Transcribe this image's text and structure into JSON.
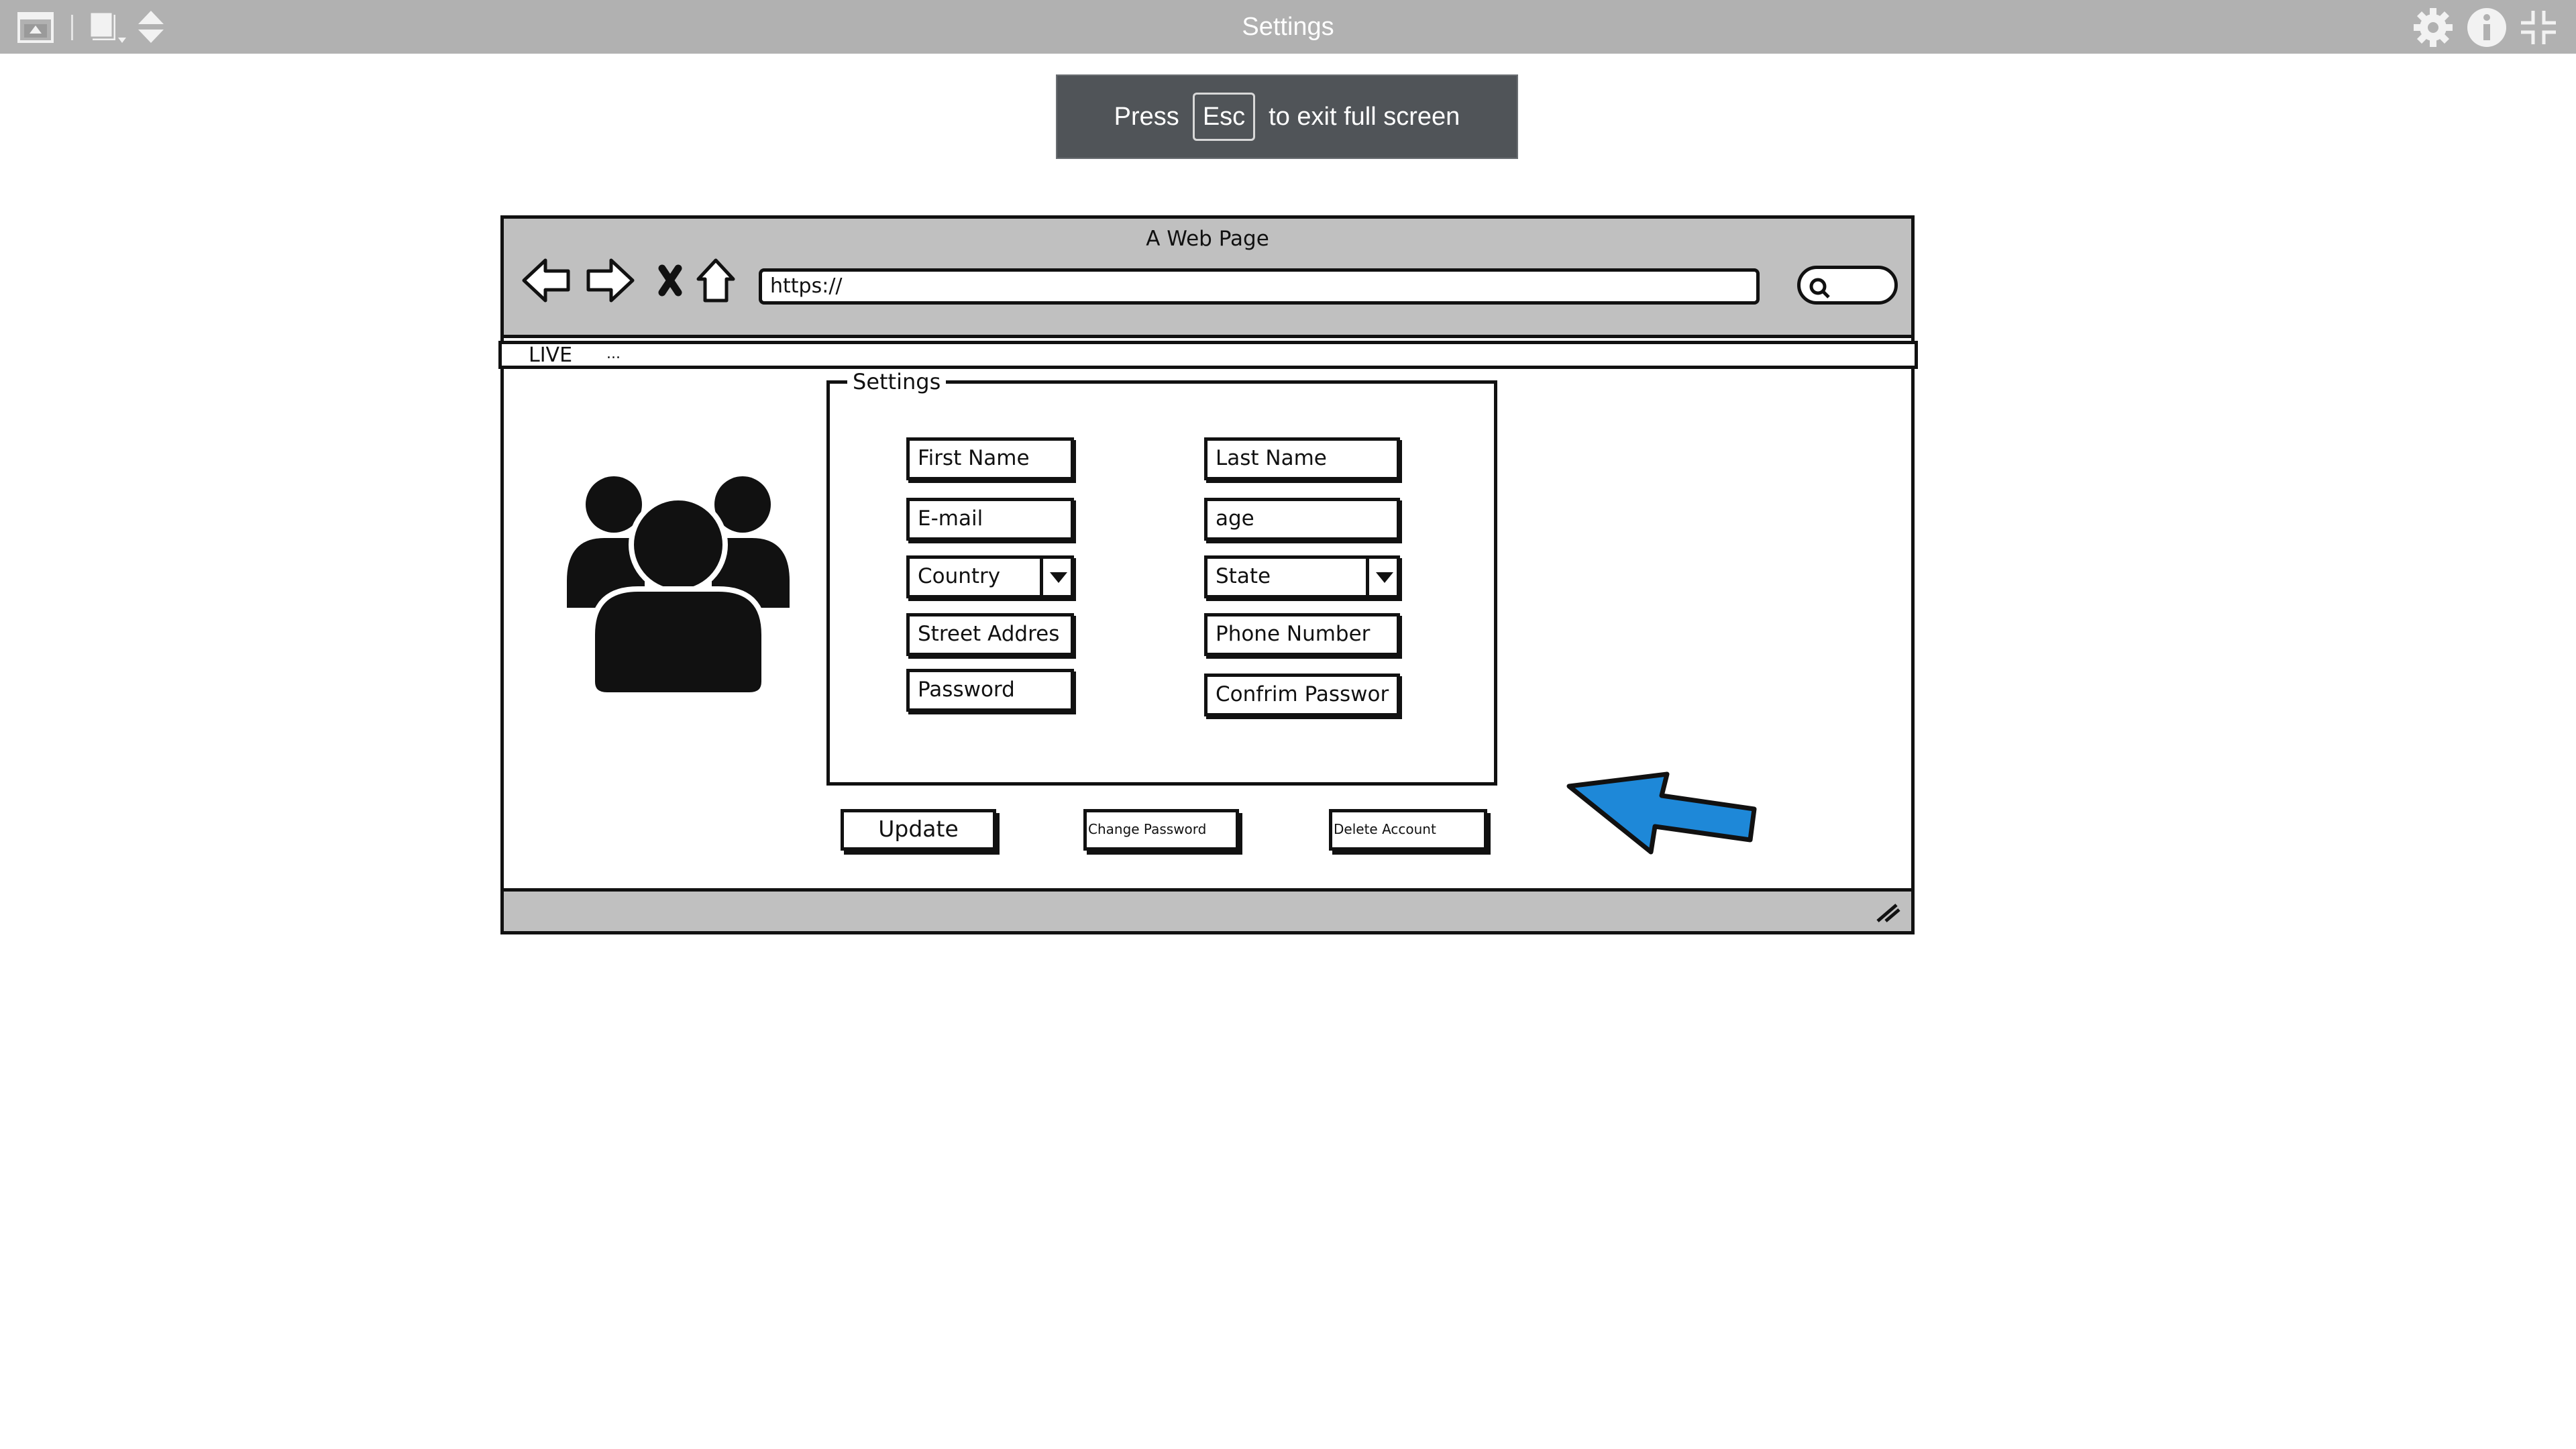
{
  "app": {
    "title": "Settings",
    "icons": [
      "window-icon",
      "pages-icon",
      "sort-arrows-icon",
      "gear-icon",
      "info-icon",
      "exit-fullscreen-icon"
    ]
  },
  "toast": {
    "prefix": "Press",
    "key": "Esc",
    "suffix": "to exit full screen"
  },
  "browser": {
    "page_title": "A Web Page",
    "url": "https://",
    "tab": "LIVE",
    "tab_more": "...",
    "nav_icons": [
      "back-arrow-icon",
      "forward-arrow-icon",
      "stop-icon",
      "home-icon",
      "search-icon"
    ]
  },
  "settings": {
    "legend": "Settings",
    "fields": {
      "first_name": "First Name",
      "last_name": "Last Name",
      "email": "E-mail",
      "age": "age",
      "country": "Country",
      "state": "State",
      "street": "Street Addres",
      "phone": "Phone Number",
      "password": "Password",
      "confirm_password": "Confrim Passwor"
    }
  },
  "buttons": {
    "update": "Update",
    "change_password": "Change Password",
    "delete_account": "Delete Account"
  },
  "colors": {
    "topbar": "#b1b1b1",
    "toast": "#505458",
    "chrome": "#c0c0c0",
    "arrow": "#1e88d8"
  }
}
